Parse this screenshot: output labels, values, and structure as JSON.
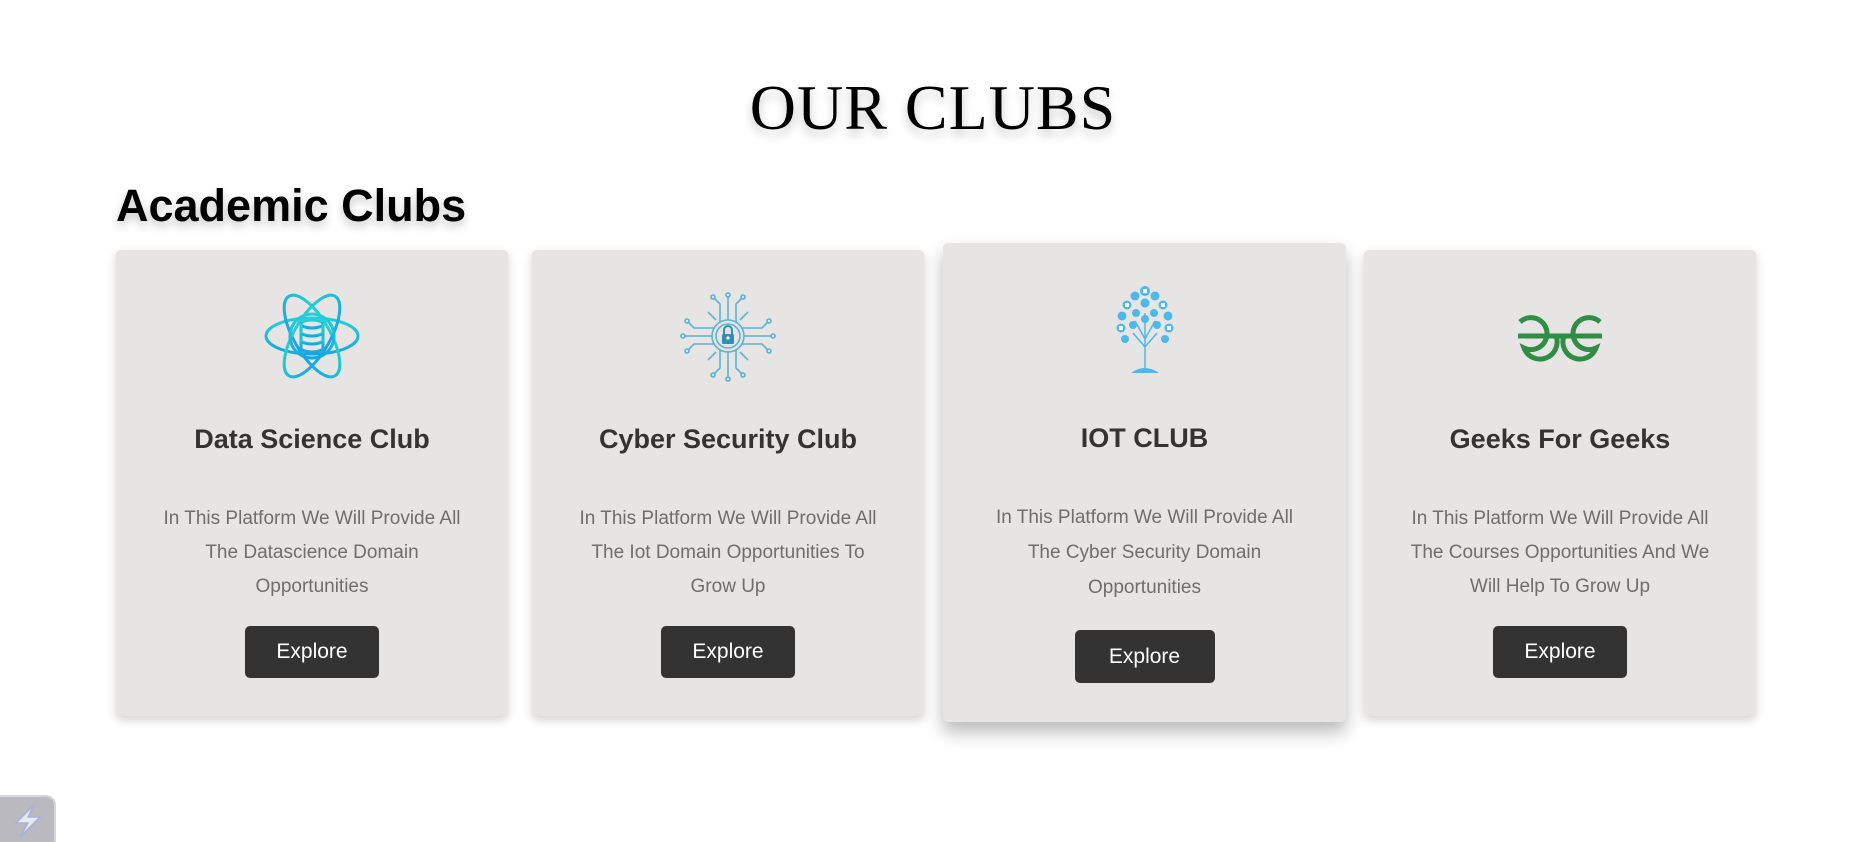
{
  "page": {
    "title": "OUR CLUBS",
    "section_title": "Academic Clubs"
  },
  "clubs": [
    {
      "title": "Data Science Club",
      "description": "In This Platform We Will Provide All The Datascience Domain Opportunities",
      "button_label": "Explore",
      "icon": "atom-database-icon",
      "icon_color": "#1ec6dc"
    },
    {
      "title": "Cyber Security Club",
      "description": "In This Platform We Will Provide All The Iot Domain Opportunities To Grow Up",
      "button_label": "Explore",
      "icon": "circuit-lock-icon",
      "icon_color": "#5ab4d2"
    },
    {
      "title": "IOT CLUB",
      "description": "In This Platform We Will Provide All The Cyber Security Domain Opportunities",
      "button_label": "Explore",
      "icon": "iot-tree-icon",
      "icon_color": "#4db8ec"
    },
    {
      "title": "Geeks For Geeks",
      "description": "In This Platform We Will Provide All The Courses Opportunities And We Will Help To Grow Up",
      "button_label": "Explore",
      "icon": "gfg-logo-icon",
      "icon_color": "#2f8d46"
    }
  ],
  "colors": {
    "card_background": "#e6e5e4",
    "button_background": "#333333",
    "button_text": "#ffffff",
    "description_text": "#6e6e6e"
  },
  "corner_widget": {
    "icon": "lightning-icon"
  }
}
